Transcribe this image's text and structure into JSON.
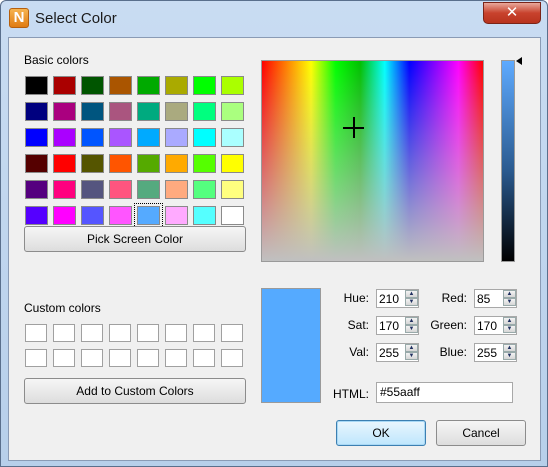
{
  "window": {
    "title": "Select Color",
    "app_icon_glyph": "N",
    "close_glyph": "✕"
  },
  "basic_colors": {
    "label": "Basic colors",
    "swatches": [
      "#000000",
      "#aa0000",
      "#005500",
      "#aa5500",
      "#00aa00",
      "#aaaa00",
      "#00ff00",
      "#aaff00",
      "#00007f",
      "#aa007f",
      "#00557f",
      "#aa557f",
      "#00aa7f",
      "#aaaa7f",
      "#00ff7f",
      "#aaff7f",
      "#0000ff",
      "#aa00ff",
      "#0055ff",
      "#aa55ff",
      "#00aaff",
      "#aaaaff",
      "#00ffff",
      "#aaffff",
      "#550000",
      "#ff0000",
      "#555500",
      "#ff5500",
      "#55aa00",
      "#ffaa00",
      "#55ff00",
      "#ffff00",
      "#55007f",
      "#ff007f",
      "#55557f",
      "#ff557f",
      "#55aa7f",
      "#ffaa7f",
      "#55ff7f",
      "#ffff7f",
      "#5500ff",
      "#ff00ff",
      "#5555ff",
      "#ff55ff",
      "#55aaff",
      "#ffaaff",
      "#55ffff",
      "#ffffff"
    ],
    "selected_index": 44
  },
  "buttons": {
    "pick_screen": "Pick Screen Color",
    "add_custom": "Add to Custom Colors",
    "ok": "OK",
    "cancel": "Cancel"
  },
  "custom_colors": {
    "label": "Custom colors",
    "count": 16
  },
  "fields": {
    "hue": {
      "label": "Hue:",
      "value": "210"
    },
    "sat": {
      "label": "Sat:",
      "value": "170"
    },
    "val": {
      "label": "Val:",
      "value": "255"
    },
    "red": {
      "label": "Red:",
      "value": "85"
    },
    "green": {
      "label": "Green:",
      "value": "170"
    },
    "blue": {
      "label": "Blue:",
      "value": "255"
    },
    "html": {
      "label": "HTML:",
      "value": "#55aaff"
    }
  },
  "colors": {
    "current": "#55aaff",
    "spin_arrow_up": "▲",
    "spin_arrow_down": "▼"
  }
}
